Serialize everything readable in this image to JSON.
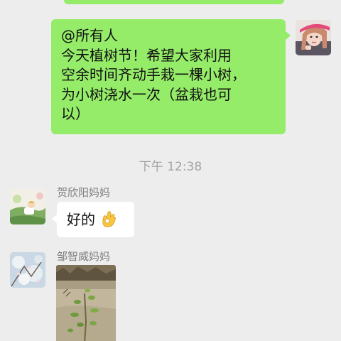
{
  "messages": [
    {
      "direction": "outgoing",
      "lines": [
        "@所有人",
        "今天植树节！希望大家利用",
        "空余时间齐动手栽一棵小树，",
        "为小树浇水一次（盆栽也可",
        "以）"
      ]
    }
  ],
  "timestamp": "下午 12:38",
  "incoming": [
    {
      "sender": "贺欣阳妈妈",
      "text": "好的",
      "emoji": "ok-hand"
    },
    {
      "sender": "邹智威妈妈",
      "attachment": "photo"
    }
  ],
  "colors": {
    "background": "#ededed",
    "outgoing_bubble": "#95ec69",
    "incoming_bubble": "#ffffff",
    "timestamp_text": "#a3a3a3",
    "sender_name_text": "#7f7f7f"
  }
}
